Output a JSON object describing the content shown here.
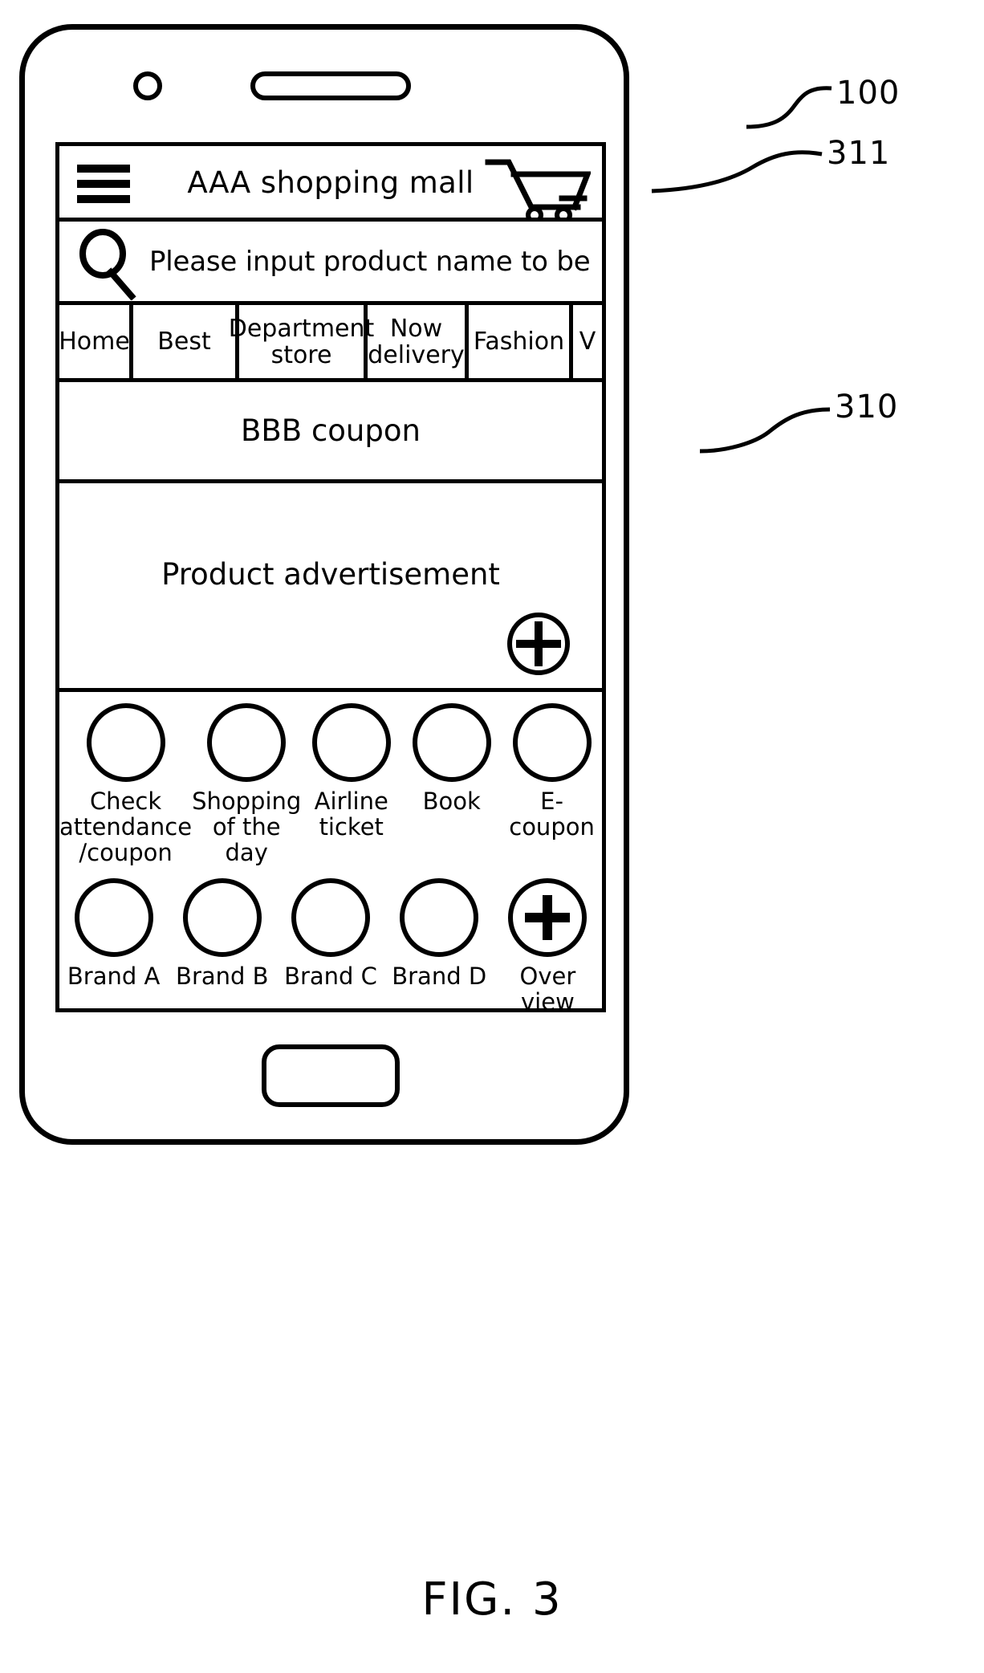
{
  "figure": {
    "caption": "FIG. 3",
    "reference_numerals": [
      {
        "id": "100",
        "label": "100",
        "target": "mobile-terminal"
      },
      {
        "id": "311",
        "label": "311",
        "target": "cart-icon"
      },
      {
        "id": "310",
        "label": "310",
        "target": "screen"
      }
    ]
  },
  "device": {
    "name": "mobile-terminal",
    "camera": "camera-lens",
    "speaker": "earpiece-speaker",
    "home_button": "home-button"
  },
  "screen": {
    "app_bar": {
      "menu_icon": "hamburger-menu-icon",
      "title": "AAA shopping mall",
      "cart_icon": "shopping-cart-icon"
    },
    "search": {
      "icon": "search-magnifier-icon",
      "value": "",
      "placeholder": "Please input product name to be found"
    },
    "tabs": [
      {
        "label": "Home",
        "selected": false
      },
      {
        "label": "Best",
        "selected": false
      },
      {
        "label": "Department\nstore",
        "selected": false
      },
      {
        "label": "Now\ndelivery",
        "selected": false
      },
      {
        "label": "Fashion",
        "selected": false
      },
      {
        "label": "V",
        "selected": false
      }
    ],
    "coupon_banner": {
      "text": "BBB coupon"
    },
    "advertisement": {
      "text": "Product advertisement",
      "add_button_icon": "plus-circle-icon"
    },
    "shortcuts": {
      "row1": [
        {
          "label": "Check\nattendance\n/coupon",
          "icon": "circle-icon"
        },
        {
          "label": "Shopping\nof the\nday",
          "icon": "circle-icon"
        },
        {
          "label": "Airline\nticket",
          "icon": "circle-icon"
        },
        {
          "label": "Book",
          "icon": "circle-icon"
        },
        {
          "label": "E-coupon",
          "icon": "circle-icon"
        }
      ],
      "row2": [
        {
          "label": "Brand A",
          "icon": "circle-icon"
        },
        {
          "label": "Brand B",
          "icon": "circle-icon"
        },
        {
          "label": "Brand C",
          "icon": "circle-icon"
        },
        {
          "label": "Brand D",
          "icon": "circle-icon"
        },
        {
          "label": "Over\nview",
          "icon": "plus-circle-icon"
        }
      ]
    }
  },
  "colors": {
    "line": "#000000",
    "background": "#ffffff"
  }
}
